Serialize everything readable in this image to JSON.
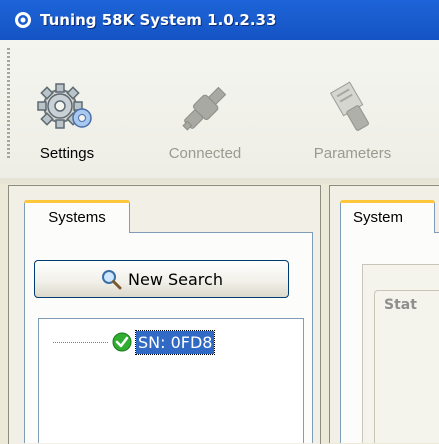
{
  "window": {
    "title": "Tuning 58K System 1.0.2.33",
    "app_icon": "app-logo-icon"
  },
  "toolbar": {
    "buttons": [
      {
        "label": "Settings",
        "icon": "gear-icon",
        "enabled": true
      },
      {
        "label": "Connected",
        "icon": "plug-icon",
        "enabled": false
      },
      {
        "label": "Parameters",
        "icon": "parameters-icon",
        "enabled": false
      }
    ]
  },
  "left_panel": {
    "tab": "Systems",
    "search_button": {
      "label": "New Search",
      "icon": "magnifier-icon"
    },
    "tree": {
      "items": [
        {
          "label": "SN: 0FD8",
          "status_icon": "check-icon",
          "selected": true
        }
      ]
    }
  },
  "right_panel": {
    "tab": "System",
    "group_title": "Stat"
  },
  "colors": {
    "titlebar": "#1a5ed0",
    "selection": "#316ac5",
    "tab_highlight": "#ffc83c",
    "success": "#2fae2f"
  }
}
